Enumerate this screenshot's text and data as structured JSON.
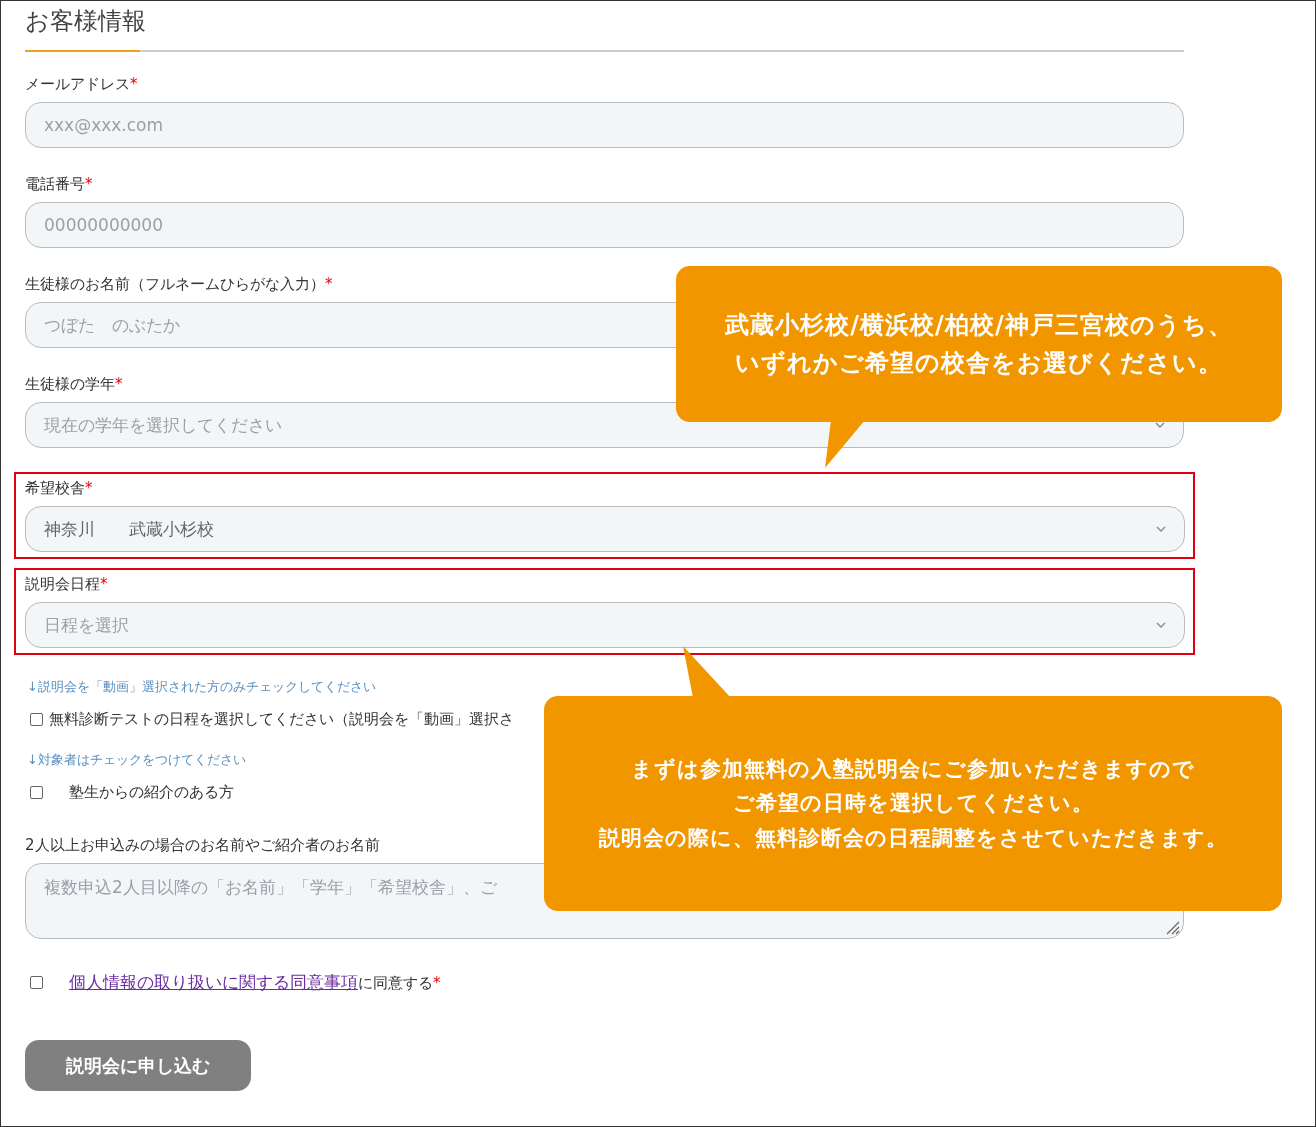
{
  "title": "お客様情報",
  "fields": [
    {
      "kind": "input",
      "label": "メールアドレス",
      "required_mark": "*",
      "placeholder": "xxx@xxx.com",
      "highlighted": false
    },
    {
      "kind": "input",
      "label": "電話番号",
      "required_mark": "*",
      "placeholder": "00000000000",
      "highlighted": false
    },
    {
      "kind": "input",
      "label": "生徒様のお名前（フルネームひらがな入力）",
      "required_mark": "*",
      "placeholder": "つぼた　のぶたか",
      "highlighted": false
    },
    {
      "kind": "select",
      "label": "生徒様の学年",
      "required_mark": "*",
      "placeholder": "現在の学年を選択してください",
      "highlighted": false
    },
    {
      "kind": "select",
      "label": "希望校舎",
      "required_mark": "*",
      "value": "神奈川　　武蔵小杉校",
      "highlighted": true
    },
    {
      "kind": "select",
      "label": "説明会日程",
      "required_mark": "*",
      "placeholder": "日程を選択",
      "highlighted": true
    }
  ],
  "options": [
    {
      "kind": "note",
      "text": "↓説明会を「動画」選択された方のみチェックしてください"
    },
    {
      "kind": "checkbox-inline",
      "label": "無料診断テストの日程を選択してください（説明会を「動画」選択さ",
      "checked": false
    },
    {
      "kind": "note",
      "text": "↓対象者はチェックをつけてください"
    },
    {
      "kind": "checkbox-spaced",
      "label": "塾生からの紹介のある方",
      "checked": false
    }
  ],
  "referral": {
    "label": "2人以上お申込みの場合のお名前やご紹介者のお名前",
    "placeholder": "複数申込2人目以降の「お名前」「学年」「希望校舎」、ご"
  },
  "consent": {
    "checked": false,
    "link": "個人情報の取り扱いに関する同意事項",
    "text": "に同意する",
    "required_mark": "*"
  },
  "submit_button": "説明会に申し込む",
  "callouts": [
    {
      "kind": "up",
      "lines": [
        "武蔵小杉校/横浜校/柏校/神戸三宮校のうち、",
        "いずれかご希望の校舎をお選びください。"
      ]
    },
    {
      "kind": "down",
      "lines": [
        "まずは参加無料の入塾説明会にご参加いただきますので",
        "ご希望の日時を選択してください。",
        "説明会の際に、無料診断会の日程調整をさせていただきます。"
      ]
    }
  ]
}
